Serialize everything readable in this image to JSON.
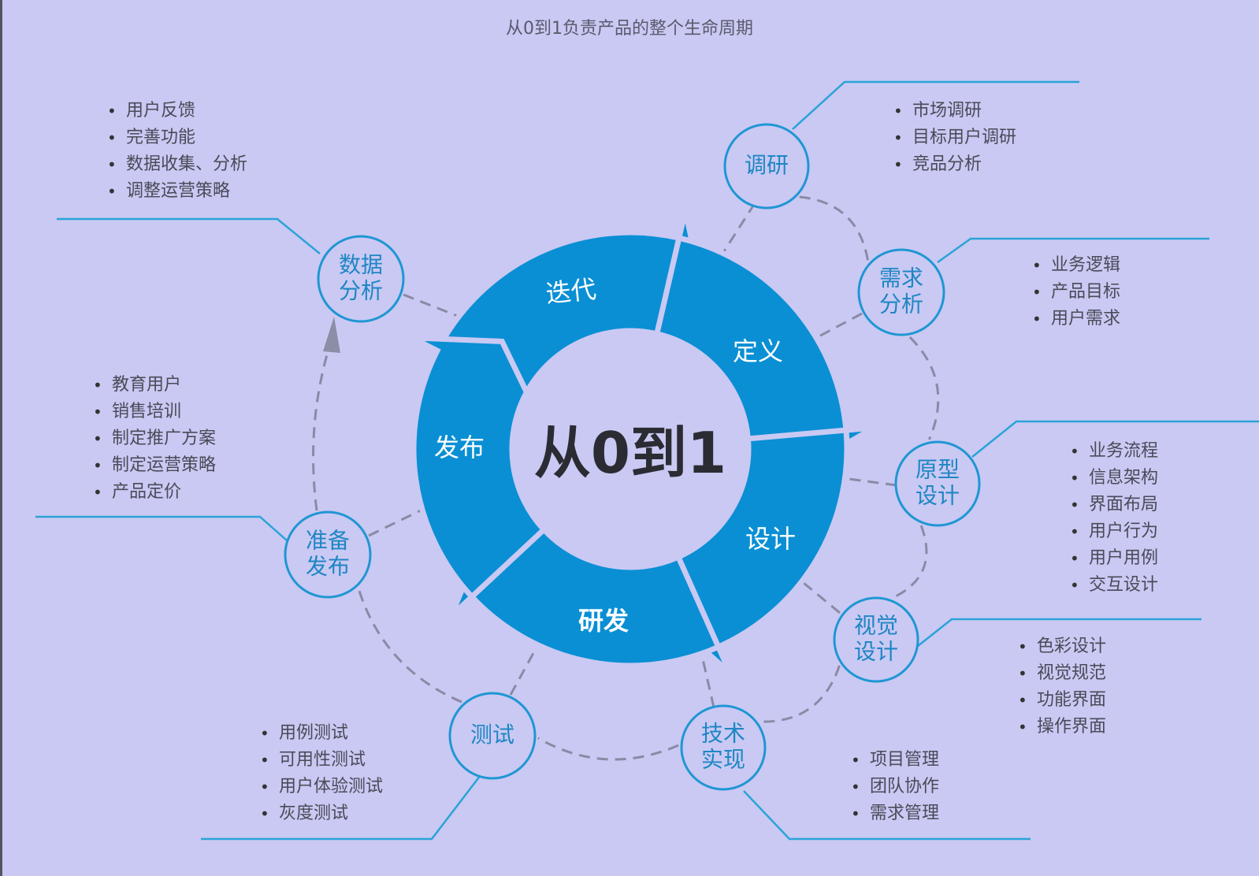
{
  "title": "从0到1负责产品的整个生命周期",
  "center_label": "从0到1",
  "colors": {
    "background": "#c9c9f3",
    "ring": "#0a8fd4",
    "node_stroke": "#1f96d3",
    "node_text": "#1f86c4",
    "leader_line": "#2aa3d8",
    "dashed_path": "#8a8aa6",
    "arrowhead": "#8a8ea6"
  },
  "ring_segments": [
    "迭代",
    "定义",
    "设计",
    "研发",
    "发布"
  ],
  "nodes": [
    {
      "id": "research",
      "lines": [
        "调研"
      ],
      "bullets": [
        "市场调研",
        "目标用户调研",
        "竞品分析"
      ]
    },
    {
      "id": "requirements",
      "lines": [
        "需求",
        "分析"
      ],
      "bullets": [
        "业务逻辑",
        "产品目标",
        "用户需求"
      ]
    },
    {
      "id": "prototype",
      "lines": [
        "原型",
        "设计"
      ],
      "bullets": [
        "业务流程",
        "信息架构",
        "界面布局",
        "用户行为",
        "用户用例",
        "交互设计"
      ]
    },
    {
      "id": "visual",
      "lines": [
        "视觉",
        "设计"
      ],
      "bullets": [
        "色彩设计",
        "视觉规范",
        "功能界面",
        "操作界面"
      ]
    },
    {
      "id": "tech",
      "lines": [
        "技术",
        "实现"
      ],
      "bullets": [
        "项目管理",
        "团队协作",
        "需求管理"
      ]
    },
    {
      "id": "testing",
      "lines": [
        "测试"
      ],
      "bullets": [
        "用例测试",
        "可用性测试",
        "用户体验测试",
        "灰度测试"
      ]
    },
    {
      "id": "launch-prep",
      "lines": [
        "准备",
        "发布"
      ],
      "bullets": [
        "教育用户",
        "销售培训",
        "制定推广方案",
        "制定运营策略",
        "产品定价"
      ]
    },
    {
      "id": "data-analysis",
      "lines": [
        "数据",
        "分析"
      ],
      "bullets": [
        "用户反馈",
        "完善功能",
        "数据收集、分析",
        "调整运营策略"
      ]
    }
  ]
}
